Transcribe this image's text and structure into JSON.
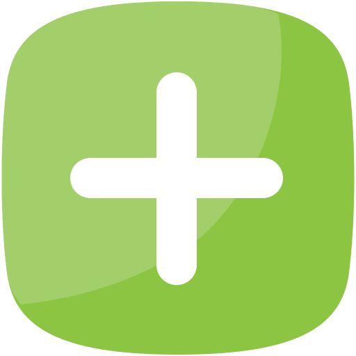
{
  "icon": {
    "name": "add-plus-icon",
    "action": "add"
  },
  "colors": {
    "base": "#8CC542",
    "highlight": "#A3CF6B",
    "glyph": "#FFFFFF"
  }
}
